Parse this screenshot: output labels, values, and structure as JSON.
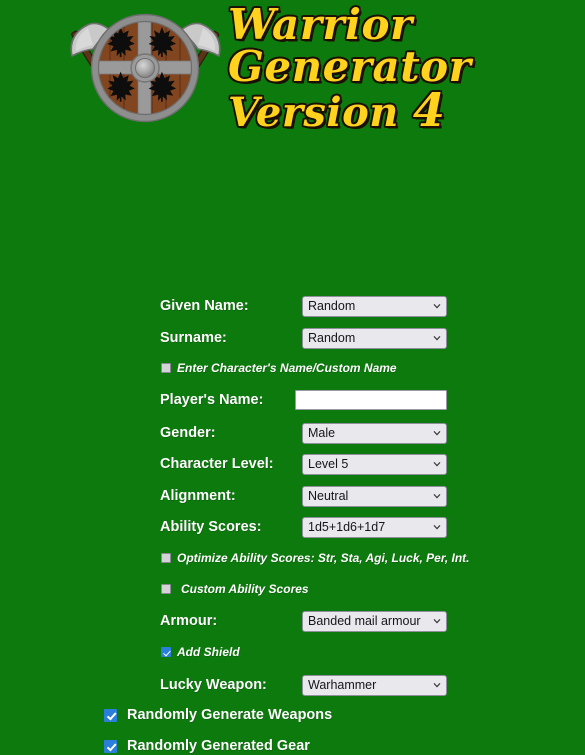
{
  "app": {
    "title_line1": "Warrior",
    "title_line2": "Generator",
    "title_line3": "Version",
    "version_number": "4",
    "background_color": "#0d7a0d",
    "title_color": "#FFD21E",
    "accent_checked_color": "#2a7fdb"
  },
  "logo": {
    "name": "shield-with-crossed-axes-logo",
    "shield_wood_color": "#8a4a22",
    "shield_rim_color": "#9a9a9a",
    "axe_blade_color": "#c9c9c9",
    "axe_handle_color": "#5a3418",
    "emblem": "maple-leaf"
  },
  "form": {
    "fields": [
      {
        "key": "given_name",
        "label": "Given Name:",
        "value": "Random"
      },
      {
        "key": "surname",
        "label": "Surname:",
        "value": "Random"
      },
      {
        "key": "player_name",
        "label": "Player's Name:",
        "value": ""
      },
      {
        "key": "gender",
        "label": "Gender:",
        "value": "Male"
      },
      {
        "key": "character_level",
        "label": "Character Level:",
        "value": "Level 5"
      },
      {
        "key": "alignment",
        "label": "Alignment:",
        "value": "Neutral"
      },
      {
        "key": "ability_scores",
        "label": "Ability Scores:",
        "value": "1d5+1d6+1d7"
      },
      {
        "key": "armour",
        "label": "Armour:",
        "value": "Banded mail armour"
      },
      {
        "key": "lucky_weapon",
        "label": "Lucky Weapon:",
        "value": "Warhammer"
      }
    ],
    "checkboxes": [
      {
        "key": "custom_name",
        "label": "Enter Character's Name/Custom Name",
        "checked": false
      },
      {
        "key": "optimize_abilities",
        "label": "Optimize Ability Scores: Str, Sta, Agi, Luck, Per, Int.",
        "checked": false
      },
      {
        "key": "custom_abilities",
        "label": "Custom Ability Scores",
        "checked": false
      },
      {
        "key": "add_shield",
        "label": "Add Shield",
        "checked": true
      },
      {
        "key": "random_weapons",
        "label": "Randomly Generate Weapons",
        "checked": true
      },
      {
        "key": "random_gear",
        "label": "Randomly Generated Gear",
        "checked": true
      }
    ]
  }
}
